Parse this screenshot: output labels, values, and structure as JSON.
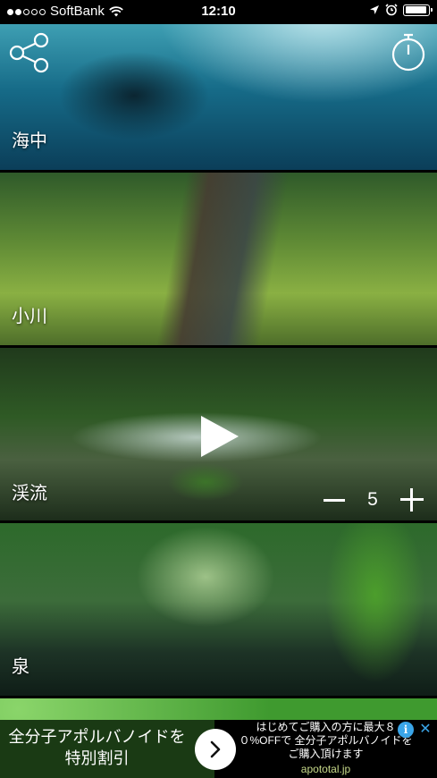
{
  "status_bar": {
    "carrier": "SoftBank",
    "time": "12:10"
  },
  "scenes": [
    {
      "label": "海中"
    },
    {
      "label": "小川"
    },
    {
      "label": "渓流",
      "count": "5"
    },
    {
      "label": "泉"
    },
    {
      "label": ""
    }
  ],
  "ad": {
    "left_line1": "全分子アポルバノイドを",
    "left_line2": "特別割引",
    "right_line1": "はじめてご購入の方に最大８",
    "right_line2": "０%OFFで 全分子アポルバノイドを",
    "right_line3": "ご購入頂けます",
    "right_domain": "apototal.jp",
    "info_glyph": "i",
    "close_glyph": "✕"
  },
  "colors": {
    "ad_accent": "#3aa5e8"
  },
  "icons": {
    "share": "share-icon",
    "timer": "timer-icon",
    "play": "play-icon",
    "arrow": "chevron-right-icon"
  }
}
